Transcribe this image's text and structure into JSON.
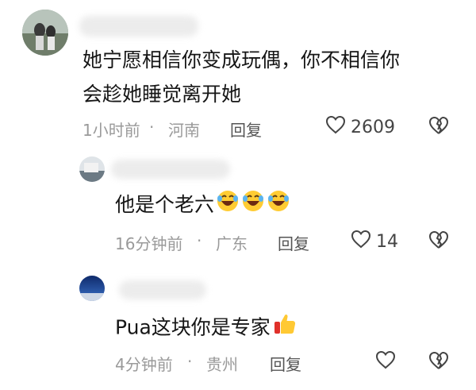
{
  "comments": [
    {
      "text_line1": "她宁愿相信你变成玩偶，你不相信你",
      "text_line2": "会趁她睡觉离开她",
      "time": "1小时前",
      "location": "河南",
      "reply_label": "回复",
      "likes": "2609"
    },
    {
      "text": "他是个老六",
      "emoji": [
        "laughing-crying-emoji",
        "laughing-crying-emoji",
        "laughing-crying-emoji"
      ],
      "time": "16分钟前",
      "location": "广东",
      "reply_label": "回复",
      "likes": "14"
    },
    {
      "text": "Pua这块你是专家",
      "emoji": [
        "thumbs-up-emoji"
      ],
      "time": "4分钟前",
      "location": "贵州",
      "reply_label": "回复",
      "likes": ""
    }
  ],
  "separator": "·",
  "colors": {
    "meta_gray": "#9a9a9a",
    "text_dark": "#161616",
    "icon_gray": "#444444"
  }
}
